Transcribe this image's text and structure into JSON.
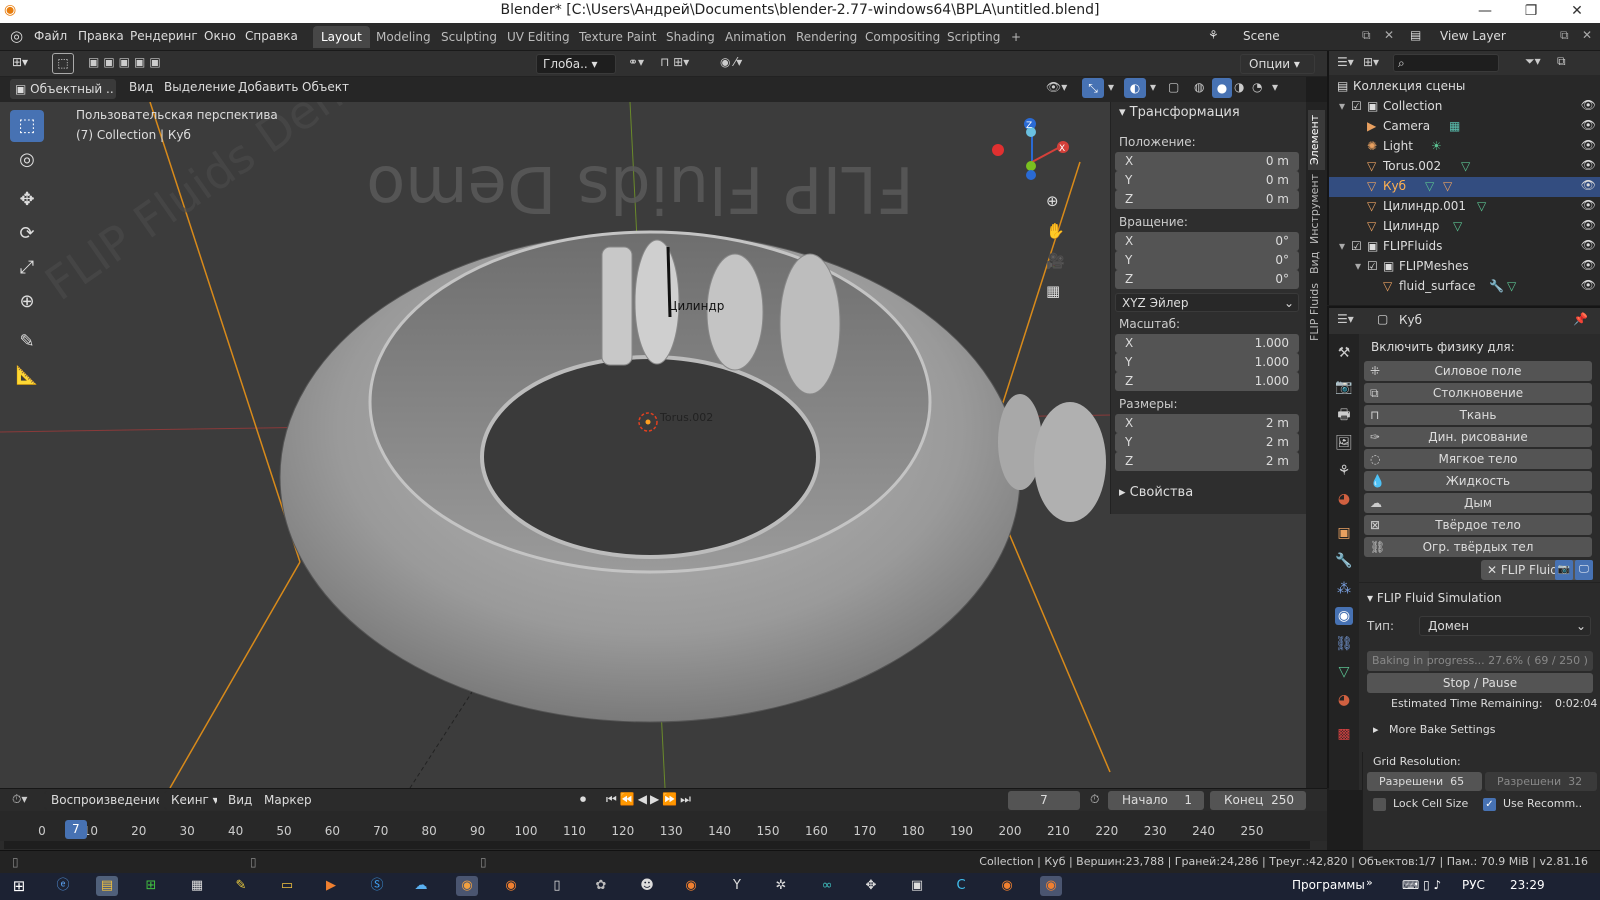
{
  "window": {
    "title": "Blender* [C:\\Users\\Андрей\\Documents\\blender-2.77-windows64\\BPLA\\untitled.blend]"
  },
  "menu": [
    "Файл",
    "Правка",
    "Рендеринг",
    "Окно",
    "Справка"
  ],
  "workspaces": [
    "Layout",
    "Modeling",
    "Sculpting",
    "UV Editing",
    "Texture Paint",
    "Shading",
    "Animation",
    "Rendering",
    "Compositing",
    "Scripting",
    "+"
  ],
  "scene": {
    "name": "Scene",
    "view_layer": "View Layer"
  },
  "header": {
    "transform_orientation": "Глоба..",
    "options": "Опции"
  },
  "viewport_header": {
    "mode": "Объектный ..",
    "items": [
      "Вид",
      "Выделение",
      "Добавить",
      "Объект"
    ]
  },
  "viewport": {
    "overlay_line1": "Пользовательская перспектива",
    "overlay_line2": "(7) Collection | Куб",
    "demo_text": "FLIP Fluids Demo",
    "label_cylinder": "Цилиндр",
    "label_torus": "Torus.002",
    "gizmo": {
      "x": "X",
      "y": "Y",
      "z": "Z"
    }
  },
  "npanel": {
    "title": "Трансформация",
    "location_label": "Положение:",
    "location": [
      {
        "k": "X",
        "v": "0 m"
      },
      {
        "k": "Y",
        "v": "0 m"
      },
      {
        "k": "Z",
        "v": "0 m"
      }
    ],
    "rotation_label": "Вращение:",
    "rotation": [
      {
        "k": "X",
        "v": "0°"
      },
      {
        "k": "Y",
        "v": "0°"
      },
      {
        "k": "Z",
        "v": "0°"
      }
    ],
    "rotation_mode": "XYZ Эйлер",
    "scale_label": "Масштаб:",
    "scale": [
      {
        "k": "X",
        "v": "1.000"
      },
      {
        "k": "Y",
        "v": "1.000"
      },
      {
        "k": "Z",
        "v": "1.000"
      }
    ],
    "dimensions_label": "Размеры:",
    "dimensions": [
      {
        "k": "X",
        "v": "2 m"
      },
      {
        "k": "Y",
        "v": "2 m"
      },
      {
        "k": "Z",
        "v": "2 m"
      }
    ],
    "properties": "Свойства",
    "tabs": [
      "Элемент",
      "Инструмент",
      "Вид",
      "FLIP Fluids"
    ]
  },
  "outliner": {
    "root": "Коллекция сцены",
    "rows": [
      {
        "name": "Collection",
        "indent": 1
      },
      {
        "name": "Camera",
        "indent": 2
      },
      {
        "name": "Light",
        "indent": 2
      },
      {
        "name": "Torus.002",
        "indent": 2
      },
      {
        "name": "Куб",
        "indent": 2,
        "selected": true
      },
      {
        "name": "Цилиндр.001",
        "indent": 2
      },
      {
        "name": "Цилиндр",
        "indent": 2
      },
      {
        "name": "FLIPFluids",
        "indent": 1
      },
      {
        "name": "FLIPMeshes",
        "indent": 2
      },
      {
        "name": "fluid_surface",
        "indent": 3
      }
    ]
  },
  "properties": {
    "object": "Куб",
    "physics_header": "Включить физику для:",
    "physics_buttons": [
      "Силовое поле",
      "Столкновение",
      "Ткань",
      "Дин. рисование",
      "Мягкое тело",
      "Жидкость",
      "Дым",
      "Твёрдое тело",
      "Огр. твёрдых тел"
    ],
    "flip_tag": "FLIP Fluid",
    "sim_title": "FLIP Fluid Simulation",
    "type_label": "Тип:",
    "type_value": "Домен",
    "bake_progress_text": "Baking in progress... 27.6%  ( 69 / 250 )",
    "bake_progress": 0.276,
    "stop_pause": "Stop / Pause",
    "time_remaining_label": "Estimated Time Remaining:",
    "time_remaining": "0:02:04",
    "more_bake": "More Bake Settings",
    "grid_resolution": "Grid Resolution:",
    "resolution": "Разрешени",
    "resolution_value": "65",
    "resolution2": "Разрешени",
    "resolution2_value": "32",
    "lock_cell_size": "Lock Cell Size",
    "use_recomm": "Use Recomm.."
  },
  "timeline": {
    "playback": "Воспроизведение",
    "keying": "Кеинг",
    "view": "Вид",
    "marker": "Маркер",
    "current_frame": "7",
    "start_label": "Начало",
    "start": "1",
    "end_label": "Конец",
    "end": "250",
    "ticks": [
      "0",
      "10",
      "20",
      "30",
      "40",
      "50",
      "60",
      "70",
      "80",
      "90",
      "100",
      "110",
      "120",
      "130",
      "140",
      "150",
      "160",
      "170",
      "180",
      "190",
      "200",
      "210",
      "220",
      "230",
      "240",
      "250"
    ],
    "cursor_frame": "7"
  },
  "status": "Collection | Куб | Вершин:23,788 | Граней:24,286 | Треуг.:42,820 | Объектов:1/7 | Пам.: 70.9 MiB | v2.81.16",
  "taskbar": {
    "programs": "Программы",
    "lang": "РУС",
    "time": "23:29"
  },
  "colors": {
    "accent": "#4772b3",
    "selected_row": "#334d80",
    "object_orange": "#e8a060",
    "outline": "#ffa020"
  }
}
